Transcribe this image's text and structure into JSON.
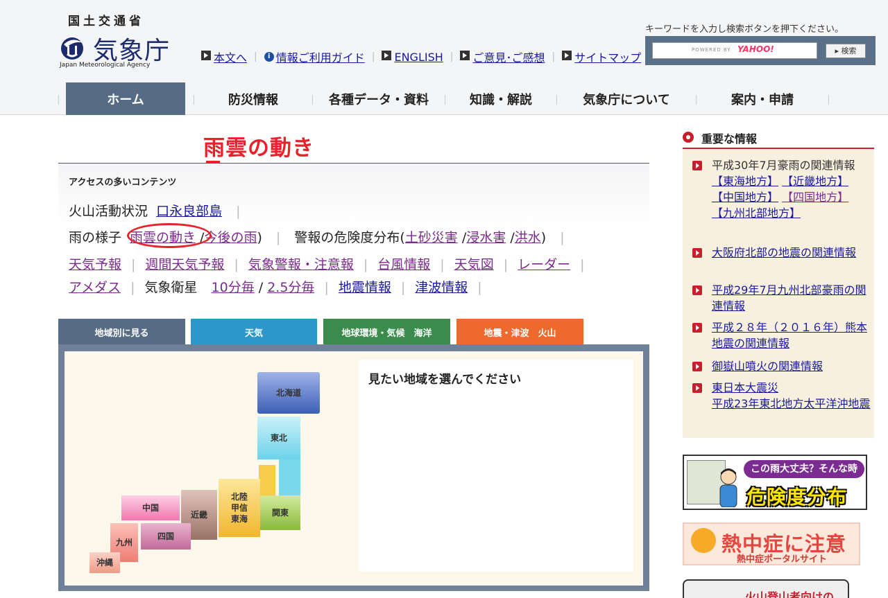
{
  "header": {
    "ministry": "国土交通省",
    "agency_name": "気象庁",
    "agency_en": "Japan Meteorological Agency",
    "top_links": [
      {
        "label": "本文へ",
        "icon": "arrow-square-icon"
      },
      {
        "label": "情報ご利用ガイド",
        "icon": "info-icon"
      },
      {
        "label": "ENGLISH",
        "icon": "arrow-square-icon"
      },
      {
        "label": "ご意見･ご感想",
        "icon": "arrow-square-icon"
      },
      {
        "label": "サイトマップ",
        "icon": "arrow-square-icon"
      }
    ],
    "search": {
      "hint": "キーワードを入力し検索ボタンを押下ください。",
      "powered_by": "POWERED BY",
      "yahoo": "YAHOO!",
      "button_label": "▸ 検索"
    }
  },
  "global_nav": [
    {
      "label": "ホーム",
      "active": true
    },
    {
      "label": "防災情報",
      "active": false
    },
    {
      "label": "各種データ・資料",
      "active": false
    },
    {
      "label": "知識・解説",
      "active": false
    },
    {
      "label": "気象庁について",
      "active": false
    },
    {
      "label": "案内・申請",
      "active": false
    }
  ],
  "annotation": {
    "title": "雨雲の動き",
    "color": "#e8222a"
  },
  "access": {
    "title": "アクセスの多いコンテンツ",
    "volcano_label": "火山活動状況",
    "volcano_link": "口永良部島",
    "rain_label": "雨の様子",
    "rain_link": "雨雲の動き",
    "rain_sep": "/",
    "forecast_rain": "今後の雨",
    "rain_close": ")",
    "warning_label": "警報の危険度分布(",
    "landslide": "土砂災害",
    "flood_in": "浸水害",
    "flood": "洪水",
    "warning_close": ")",
    "links_row3": [
      "天気予報",
      "週間天気予報",
      "気象警報・注意報",
      "台風情報",
      "天気図",
      "レーダー"
    ],
    "amedas": "アメダス",
    "satellite_label": "気象衛星",
    "sat_10": "10分毎",
    "sat_slash": "/",
    "sat_25": "2.5分毎",
    "earthquake": "地震情報",
    "tsunami": "津波情報"
  },
  "tabs": [
    {
      "label": "地域別に見る",
      "color": "#566b84"
    },
    {
      "label": "天気",
      "color": "#2e97c9"
    },
    {
      "label": "地球環境・気候　海洋",
      "color": "#3b8c4c"
    },
    {
      "label": "地震・津波　火山",
      "color": "#ee6a2c"
    }
  ],
  "regions": [
    {
      "label": "北海道"
    },
    {
      "label": "東北"
    },
    {
      "label": "北陸\n甲信\n東海"
    },
    {
      "label": "関東"
    },
    {
      "label": "近畿"
    },
    {
      "label": "中国"
    },
    {
      "label": "四国"
    },
    {
      "label": "九州"
    },
    {
      "label": "沖縄"
    }
  ],
  "select_region_label": "見たい地域を選んでください",
  "important": {
    "heading": "重要な情報",
    "items": [
      {
        "text": "平成30年7月豪雨の関連情報",
        "sub": [
          "【東海地方】",
          "【近畿地方】",
          "【中国地方】",
          "【四国地方】",
          "【九州北部地方】"
        ]
      },
      {
        "text": "大阪府北部の地震の関連情報"
      },
      {
        "text": "平成29年7月九州北部豪雨の関連情報"
      },
      {
        "text": "平成２８年（２０１６年）熊本地震の関連情報"
      },
      {
        "text": "御嶽山噴火の関連情報"
      },
      {
        "text": "東日本大震災\n平成23年東北地方太平洋沖地震"
      }
    ]
  },
  "banners": {
    "danger_tag": "この雨大丈夫？そんな時",
    "danger_main": "危険度分布",
    "heat_main": "熱中症に注意",
    "heat_sub": "熱中症ポータルサイト",
    "volcano_climb": "火山登山者向けの"
  }
}
